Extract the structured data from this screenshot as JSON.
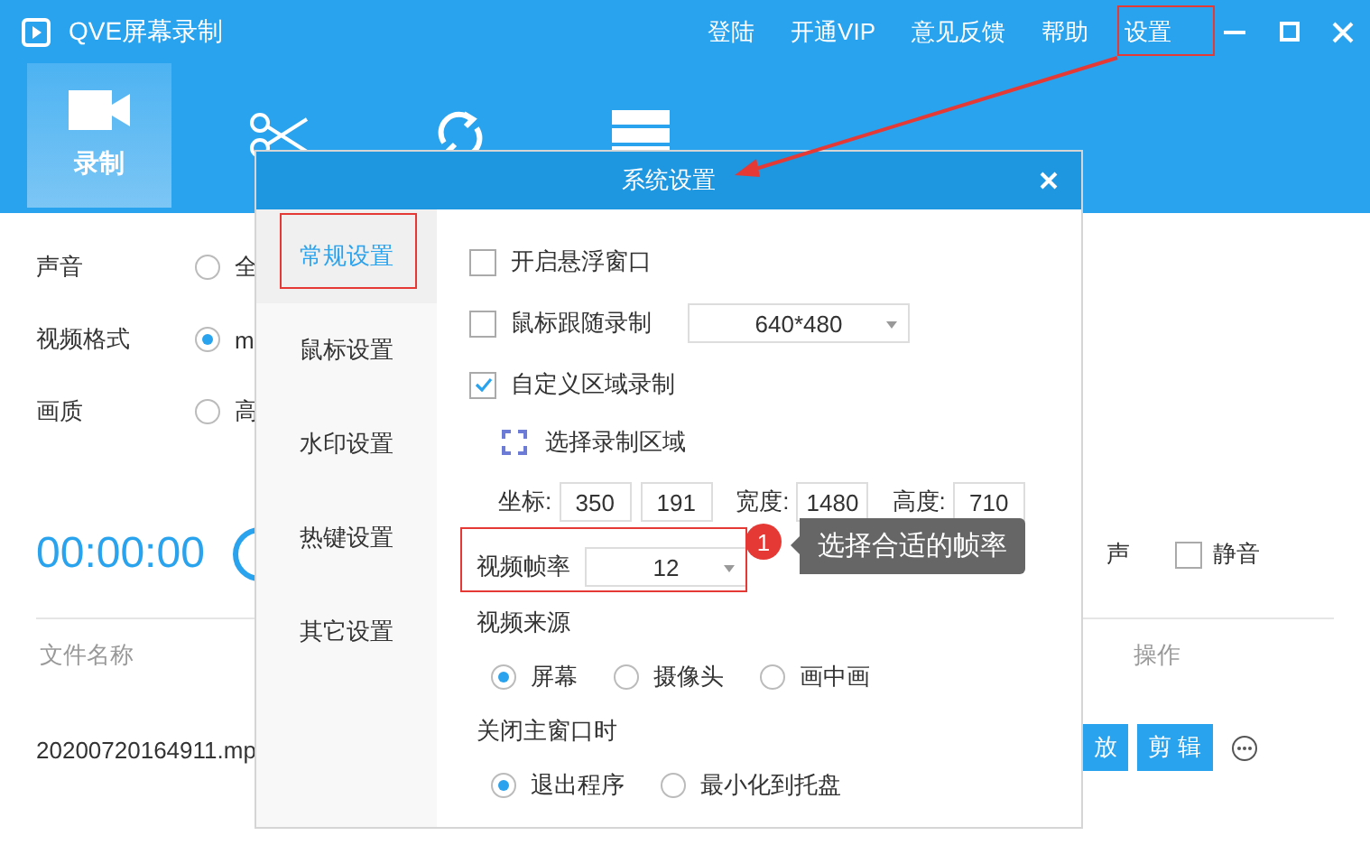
{
  "window": {
    "title": "QVE屏幕录制"
  },
  "top_menu": [
    "登陆",
    "开通VIP",
    "意见反馈",
    "帮助",
    "设置"
  ],
  "toolbar_tabs": [
    {
      "kind": "camera",
      "label": "录制",
      "selected": true
    },
    {
      "kind": "scissors",
      "selected": false
    },
    {
      "kind": "refresh",
      "selected": false
    },
    {
      "kind": "list",
      "selected": false
    }
  ],
  "record_settings": [
    {
      "label": "声音",
      "option": "全",
      "selected": false
    },
    {
      "label": "视频格式",
      "option": "m",
      "selected": true
    },
    {
      "label": "画质",
      "option": "高",
      "selected": false
    }
  ],
  "timer": "00:00:00",
  "noise_label": "声",
  "mute": {
    "label": "静音",
    "checked": false
  },
  "file_table": {
    "columns": [
      "文件名称",
      "操作"
    ],
    "rows": [
      {
        "name": "20200720164911.mp",
        "actions": [
          "放",
          "剪 辑"
        ]
      }
    ]
  },
  "dialog": {
    "title": "系统设置",
    "tabs": [
      {
        "label": "常规设置",
        "selected": true
      },
      {
        "label": "鼠标设置",
        "selected": false
      },
      {
        "label": "水印设置",
        "selected": false
      },
      {
        "label": "热键设置",
        "selected": false
      },
      {
        "label": "其它设置",
        "selected": false
      }
    ],
    "checkboxes": [
      {
        "label": "开启悬浮窗口",
        "checked": false
      },
      {
        "label": "鼠标跟随录制",
        "checked": false,
        "select": "640*480"
      },
      {
        "label": "自定义区域录制",
        "checked": true
      }
    ],
    "select_area": "选择录制区域",
    "coords": [
      {
        "label": "坐标:",
        "values": [
          "350",
          "191"
        ]
      },
      {
        "label": "宽度:",
        "values": [
          "1480"
        ]
      },
      {
        "label": "高度:",
        "values": [
          "710"
        ]
      }
    ],
    "frame_rate": {
      "label": "视频帧率",
      "value": "12"
    },
    "video_source": {
      "label": "视频来源",
      "options": [
        {
          "label": "屏幕",
          "selected": true
        },
        {
          "label": "摄像头",
          "selected": false
        },
        {
          "label": "画中画",
          "selected": false
        }
      ]
    },
    "on_close": {
      "label": "关闭主窗口时",
      "options": [
        {
          "label": "退出程序",
          "selected": true
        },
        {
          "label": "最小化到托盘",
          "selected": false
        }
      ]
    }
  },
  "annotation": {
    "badge": "1",
    "tip": "选择合适的帧率"
  }
}
